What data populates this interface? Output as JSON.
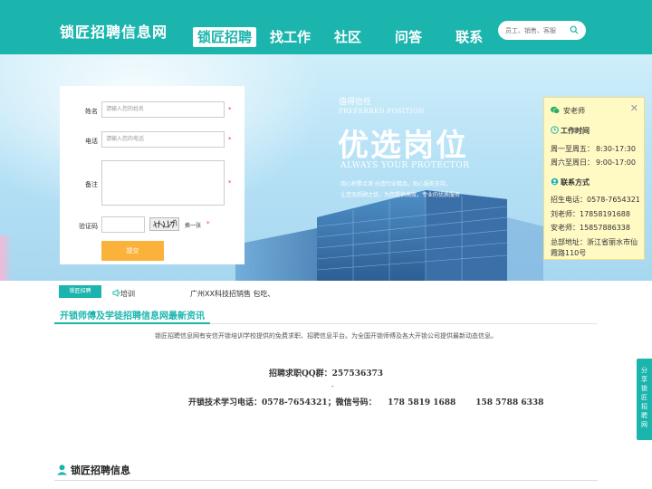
{
  "header": {
    "logo": "锁匠招聘信息网",
    "nav": [
      "锁匠招聘",
      "找工作",
      "社区",
      "问答",
      "联系"
    ],
    "search_placeholder": "员工、销售、客服"
  },
  "form": {
    "name_label": "姓名",
    "name_placeholder": "请输入您的姓名",
    "phone_label": "电话",
    "phone_placeholder": "请输入您的电话",
    "note_label": "备注",
    "captcha_label": "验证码",
    "captcha_refresh": "换一张",
    "required_mark": "*",
    "submit_label": "提交"
  },
  "banner": {
    "small_cn": "值得信任",
    "small_en": "PREFERRED POSITION",
    "title": "优选岗位",
    "subtitle": "ALWAYS YOUR PROTECTOR",
    "desc1": "用心积累点滴 创造行业精品，贴心服务支持，",
    "desc2": "让您无后顾之忧，为您提供高效，专业的优质服务"
  },
  "contact": {
    "name": "安老师",
    "hours_title": "工作时间",
    "hours1_day": "周一至周五：",
    "hours1_time": "8:30-17:30",
    "hours2_day": "周六至周日：",
    "hours2_time": "9:00-17:00",
    "contact_title": "联系方式",
    "phone1": "招生电话：0578-7654321",
    "phone2": "刘老师：17858191688",
    "phone3": "安老师：15857886338",
    "address1": "总部地址：浙江省丽水市仙",
    "address2": "霞路110号"
  },
  "ticker": {
    "tab": "锁匠招聘",
    "label": "培训",
    "text": "广州XX科技招销售   包吃、"
  },
  "section": {
    "title": "开锁师傅及学徒招聘信息网最新资讯",
    "intro": "锁匠招聘信息网有安信开锁培训学校提供的免费求职、招聘信息平台。为全国开锁师傅及各大开锁公司提供最新动态信息。",
    "qq": "招聘求职QQ群：257536373",
    "dash": "-",
    "phones": "开锁技术学习电话：0578-7654321；微信号码：    178 5819 1688       158 5788 6338"
  },
  "bottom_title": "锁匠招聘信息",
  "share_label": "分享锁匠招聘网",
  "colors": {
    "brand": "#1bb5ad",
    "submit": "#fbb23a"
  }
}
